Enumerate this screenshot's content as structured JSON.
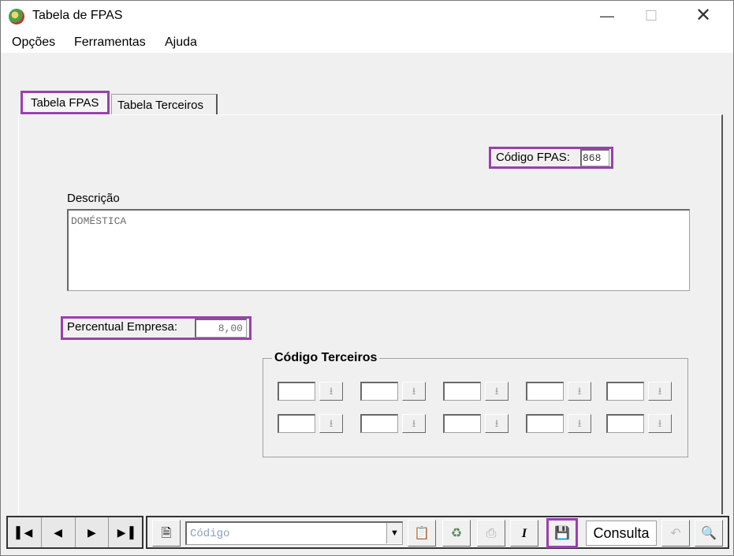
{
  "window": {
    "title": "Tabela de FPAS",
    "min_icon": "minimize-icon",
    "max_icon": "maximize-icon",
    "close_icon": "close-icon"
  },
  "menu": [
    "Opções",
    "Ferramentas",
    "Ajuda"
  ],
  "tabs": [
    {
      "label": "Tabela FPAS"
    },
    {
      "label": "Tabela Terceiros"
    }
  ],
  "form": {
    "codigo_label": "Código FPAS:",
    "codigo_value": "868",
    "descricao_label": "Descrição",
    "descricao_value": "DOMÉSTICA",
    "percentual_label": "Percentual Empresa:",
    "percentual_value": "8,00",
    "terceiros_title": "Código Terceiros"
  },
  "toolbar": {
    "nav": [
      "first-record-icon",
      "previous-record-icon",
      "next-record-icon",
      "last-record-icon"
    ],
    "search_placeholder": "Código",
    "consulta_label": "Consulta"
  },
  "colors": {
    "highlight": "#9b3fae"
  }
}
